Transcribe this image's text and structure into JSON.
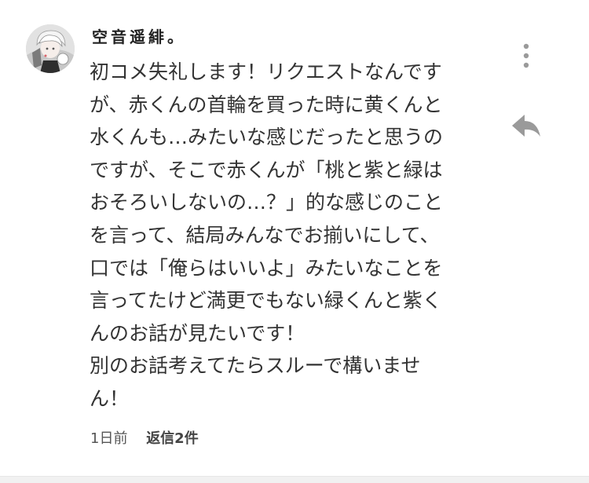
{
  "comment": {
    "username": "空音遥緋。",
    "body_lines": [
      "初コメ失礼します！リクエストなんです",
      "が、赤くんの首輪を買った時に黄くんと",
      "水くんも…みたいな感じだったと思うの",
      "ですが、そこで赤くんが「桃と紫と緑は",
      "おそろいしないの…？」的な感じのこと",
      "を言って、結局みんなでお揃いにして、",
      "口では「俺らはいいよ」みたいなことを",
      "言ってたけど満更でもない緑くんと紫く",
      "んのお話が見たいです！",
      "別のお話考えてたらスルーで構いませ",
      "ん！"
    ],
    "timestamp": "1日前",
    "replies_label": "返信2件"
  },
  "icons": {
    "menu": "more-vertical-icon",
    "reply": "reply-arrow-icon",
    "avatar": "user-avatar"
  },
  "colors": {
    "text": "#333333",
    "icon": "#9a9a9a",
    "divider": "#f1f1f1"
  }
}
